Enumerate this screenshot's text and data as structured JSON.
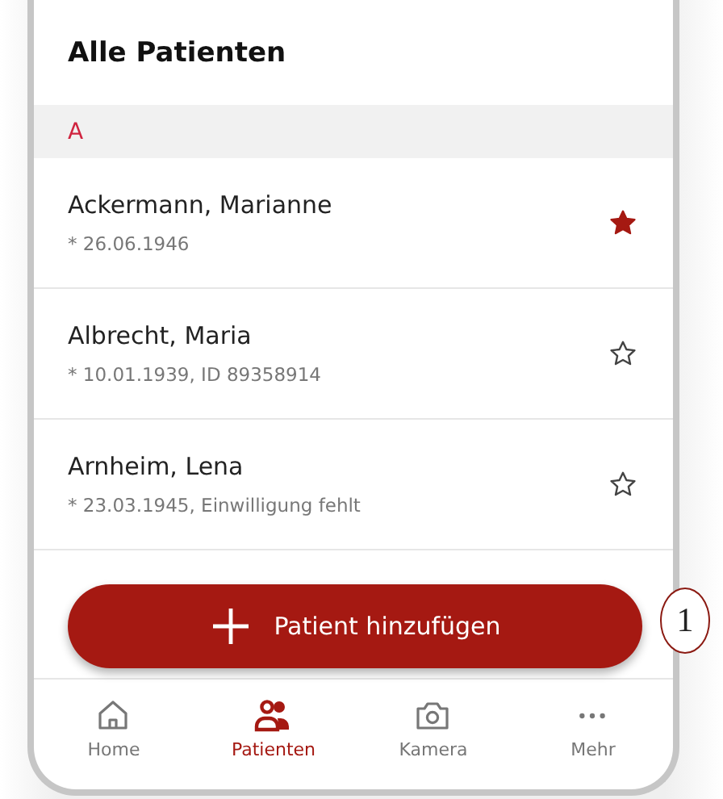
{
  "title": "Alle Patienten",
  "sections": [
    {
      "letter": "A",
      "patients": [
        {
          "name": "Ackermann, Marianne",
          "details": "* 26.06.1946",
          "favorite": true
        },
        {
          "name": "Albrecht, Maria",
          "details": "* 10.01.1939, ID 89358914",
          "favorite": false
        },
        {
          "name": "Arnheim, Lena",
          "details": "* 23.03.1945, Einwilligung fehlt",
          "favorite": false
        }
      ]
    }
  ],
  "add_button": {
    "label": "Patient hinzufügen"
  },
  "callout": "1",
  "nav": [
    {
      "kind": "home",
      "label": "Home",
      "selected": false
    },
    {
      "kind": "patients",
      "label": "Patienten",
      "selected": true
    },
    {
      "kind": "camera",
      "label": "Kamera",
      "selected": false
    },
    {
      "kind": "more",
      "label": "Mehr",
      "selected": false
    }
  ]
}
